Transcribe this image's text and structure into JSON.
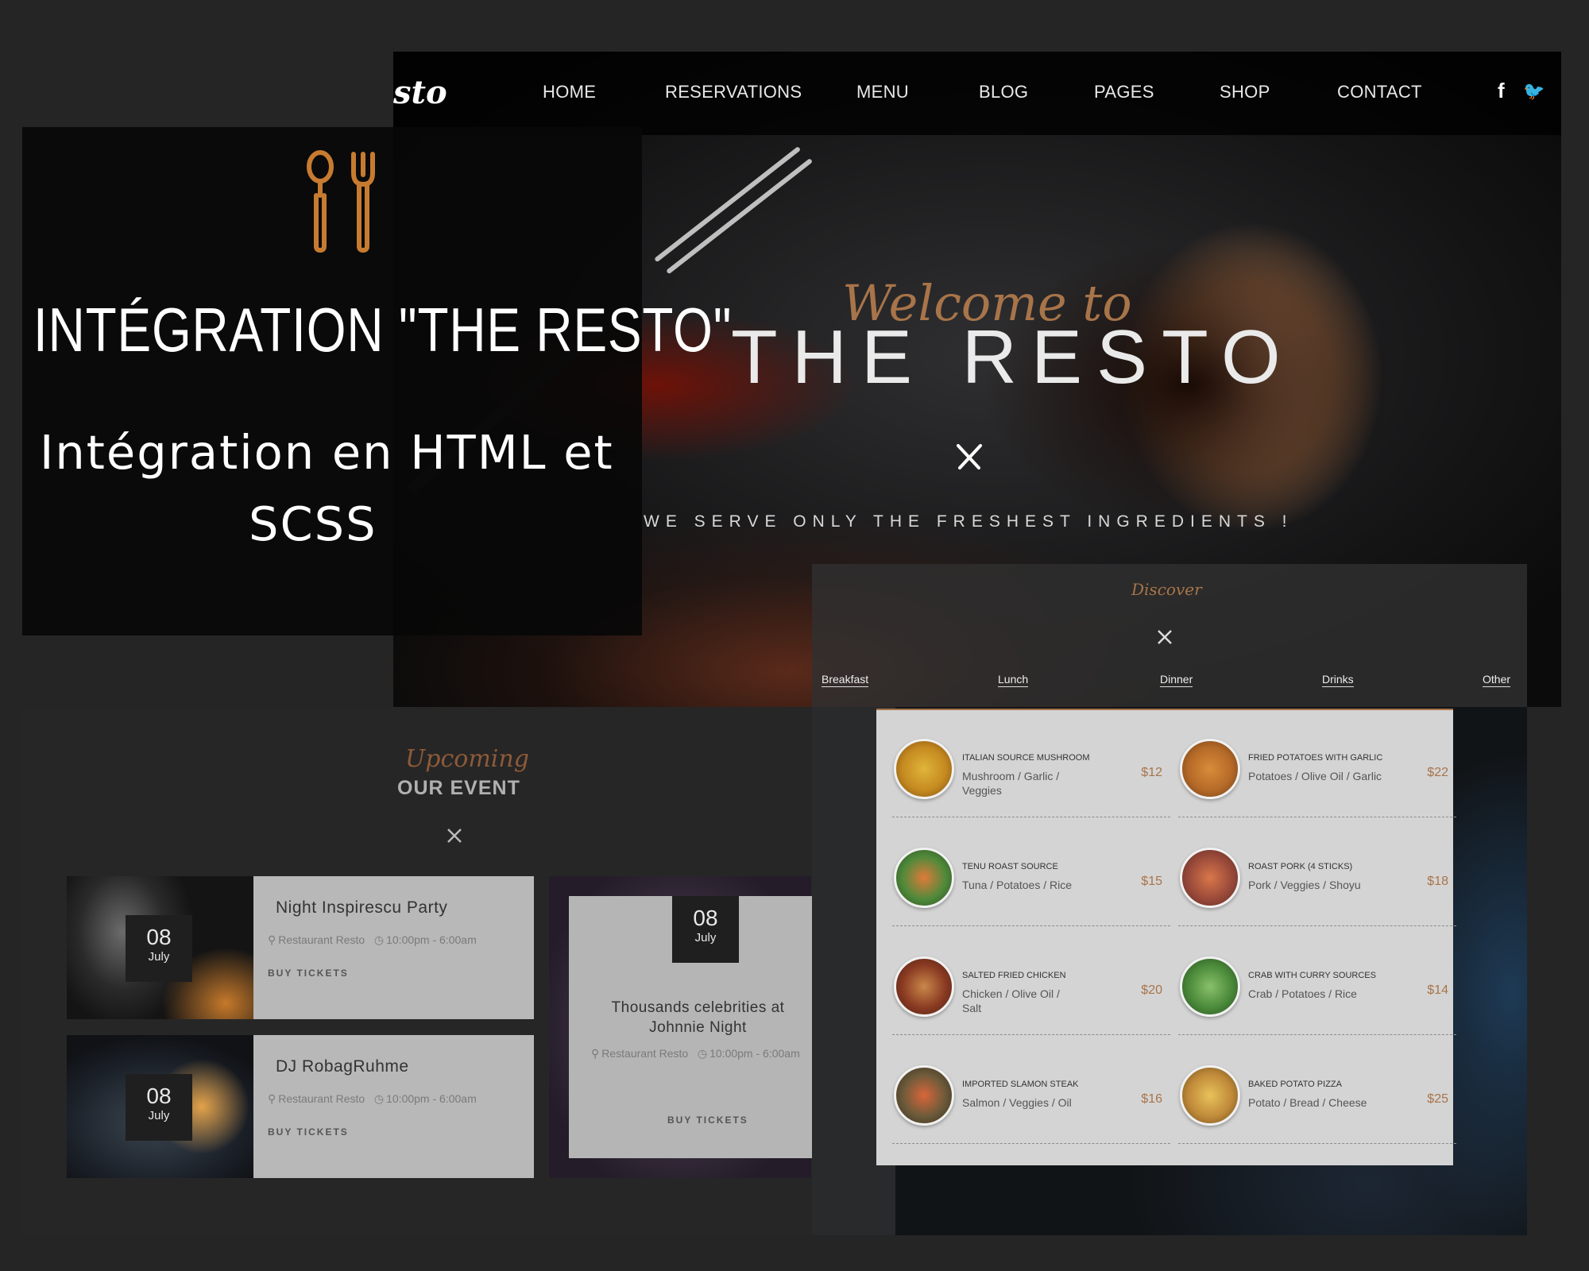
{
  "colors": {
    "accent": "#a87449",
    "background": "#252525",
    "overlay": "#0a0a0a",
    "menu_card": "#d4d4d4"
  },
  "overlay": {
    "icon": "spoon-fork-icon",
    "title": "INTÉGRATION \"THE RESTO\"",
    "subtitle_line1": "Intégration en HTML et",
    "subtitle_line2": "SCSS"
  },
  "hero": {
    "logo": "sto",
    "nav": [
      "HOME",
      "RESERVATIONS",
      "MENU",
      "BLOG",
      "PAGES",
      "SHOP",
      "CONTACT"
    ],
    "social": [
      "facebook-icon",
      "twitter-icon"
    ],
    "social_glyphs": [
      "f",
      "🐦"
    ],
    "welcome": "Welcome to",
    "title": "THE RESTO",
    "tagline": "WE SERVE ONLY THE FRESHEST INGREDIENTS !"
  },
  "discover": {
    "title": "Discover",
    "items": [
      "Breakfast",
      "Lunch",
      "Dinner",
      "Drinks",
      "Other"
    ]
  },
  "events": {
    "upcoming": "Upcoming",
    "heading": "OUR EVENT",
    "items": [
      {
        "day": "08",
        "month": "July",
        "name": "Night Inspirescu Party",
        "place": "Restaurant Resto",
        "time": "10:00pm - 6:00am",
        "cta": "BUY TICKETS"
      },
      {
        "day": "08",
        "month": "July",
        "name": "DJ RobagRuhme",
        "place": "Restaurant Resto",
        "time": "10:00pm - 6:00am",
        "cta": "BUY TICKETS"
      },
      {
        "day": "08",
        "month": "July",
        "name": "Thousands celebrities at Johnnie Night",
        "place": "Restaurant Resto",
        "time": "10:00pm - 6:00am",
        "cta": "BUY TICKETS"
      }
    ]
  },
  "menu": {
    "items": [
      {
        "name": "ITALIAN SOURCE MUSHROOM",
        "desc": "Mushroom / Garlic / Veggies",
        "price": "$12"
      },
      {
        "name": "FRIED POTATOES WITH GARLIC",
        "desc": "Potatoes / Olive Oil / Garlic",
        "price": "$22"
      },
      {
        "name": "TENU ROAST SOURCE",
        "desc": "Tuna / Potatoes / Rice",
        "price": "$15"
      },
      {
        "name": "ROAST PORK (4 STICKS)",
        "desc": "Pork / Veggies / Shoyu",
        "price": "$18"
      },
      {
        "name": "SALTED FRIED CHICKEN",
        "desc": "Chicken / Olive Oil / Salt",
        "price": "$20"
      },
      {
        "name": "CRAB WITH CURRY SOURCES",
        "desc": "Crab / Potatoes / Rice",
        "price": "$14"
      },
      {
        "name": "IMPORTED SLAMON STEAK",
        "desc": "Salmon / Veggies / Oil",
        "price": "$16"
      },
      {
        "name": "BAKED POTATO PIZZA",
        "desc": "Potato / Bread / Cheese",
        "price": "$25"
      }
    ]
  }
}
